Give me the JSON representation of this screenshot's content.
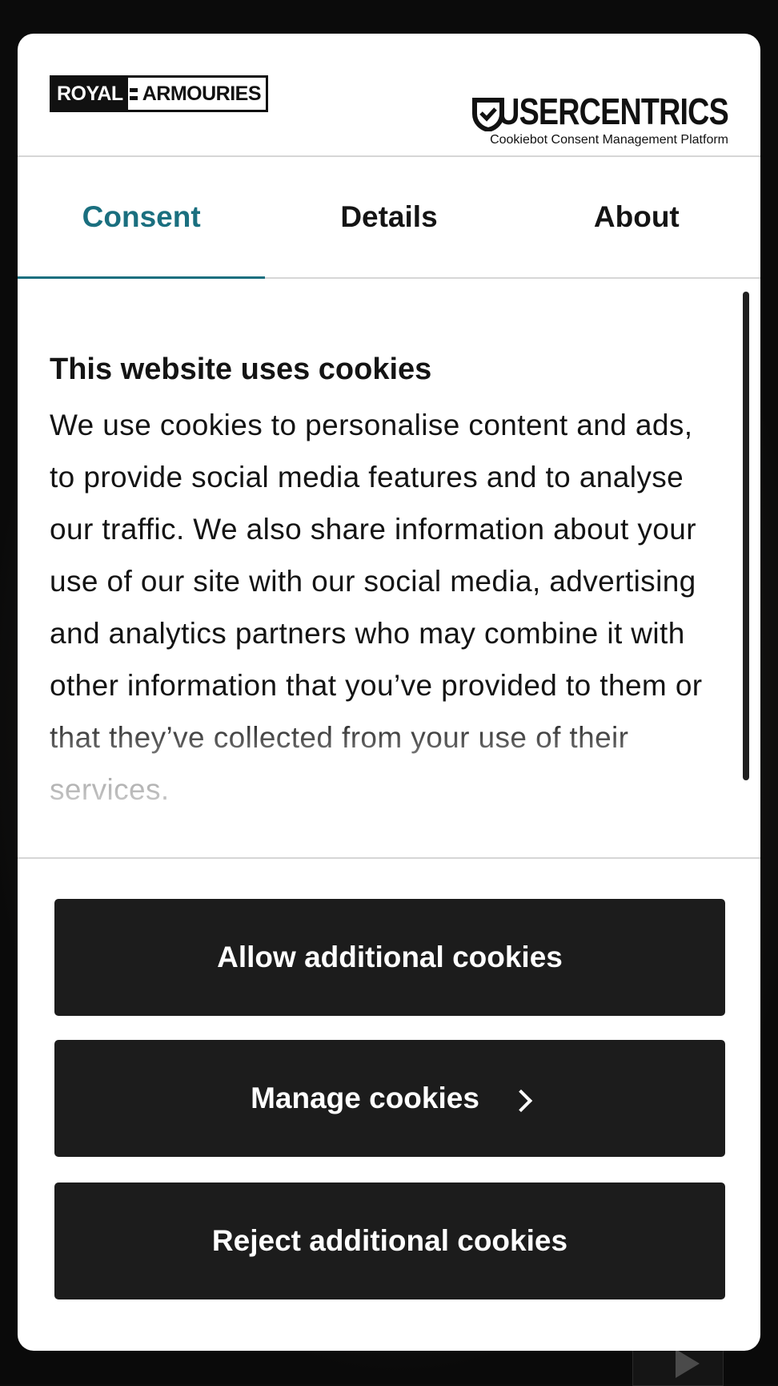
{
  "header": {
    "site_logo": {
      "part1": "ROYAL",
      "part2": "ARMOURIES"
    },
    "provider_logo": {
      "name": "USERCENTRICS",
      "tagline": "Cookiebot Consent Management Platform",
      "icon": "shield-check-icon"
    }
  },
  "tabs": [
    {
      "label": "Consent",
      "active": true
    },
    {
      "label": "Details",
      "active": false
    },
    {
      "label": "About",
      "active": false
    }
  ],
  "content": {
    "title": "This website uses cookies",
    "body": "We use cookies to personalise content and ads, to provide social media features and to analyse our traffic. We also share information about your use of our site with our social media, advertising and analytics partners who may combine it with other information that you’ve provided to them or that they’ve collected from your use of their services."
  },
  "buttons": {
    "allow": "Allow additional cookies",
    "manage": "Manage cookies",
    "reject": "Reject additional cookies"
  },
  "colors": {
    "accent": "#1a6f7f",
    "button_bg": "#1c1c1c",
    "text": "#141414"
  }
}
